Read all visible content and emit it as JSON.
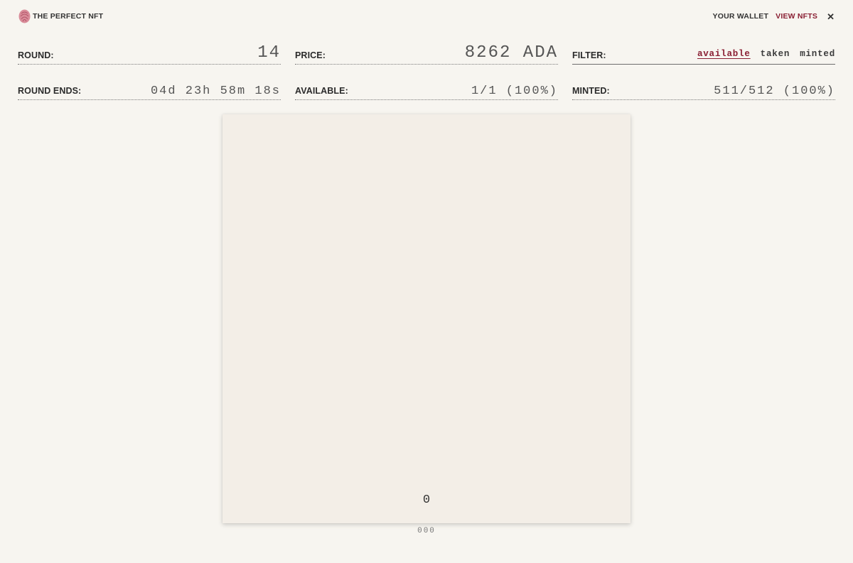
{
  "header": {
    "brand": "THE PERFECT NFT",
    "logo_icon": "fingerprint-icon",
    "nav": {
      "wallet": "YOUR WALLET",
      "view_nfts": "VIEW NFTS",
      "close": "✕"
    }
  },
  "stats": {
    "round": {
      "label": "ROUND:",
      "value": "14"
    },
    "price": {
      "label": "PRICE:",
      "value": "8262 ADA"
    },
    "round_ends": {
      "label": "ROUND ENDS:",
      "value": "04d 23h 58m 18s"
    },
    "available": {
      "label": "AVAILABLE:",
      "value": "1/1 (100%)"
    },
    "minted": {
      "label": "MINTED:",
      "value": "511/512 (100%)"
    }
  },
  "filter": {
    "label": "FILTER:",
    "options": [
      "available",
      "taken",
      "minted"
    ],
    "selected": "available"
  },
  "card": {
    "number": "0",
    "id": "000"
  },
  "colors": {
    "accent": "#8a1f33",
    "background": "#f7f5f0",
    "card": "#f3eee7"
  }
}
